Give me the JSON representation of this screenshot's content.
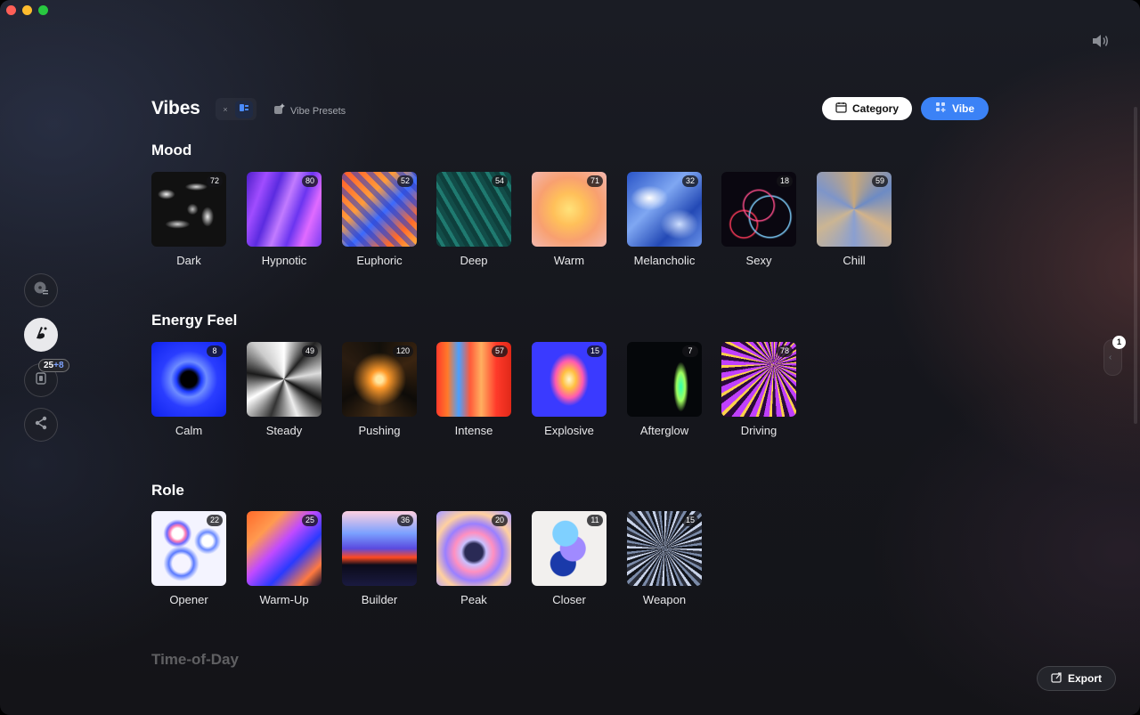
{
  "header": {
    "title": "Vibes",
    "chip_close": "×",
    "presets_label": "Vibe Presets",
    "category_button": "Category",
    "vibe_button": "Vibe"
  },
  "rail": {
    "badge_count": "25",
    "badge_extra": "+8"
  },
  "sections": [
    {
      "title": "Mood",
      "tiles": [
        {
          "label": "Dark",
          "count": "72"
        },
        {
          "label": "Hypnotic",
          "count": "80"
        },
        {
          "label": "Euphoric",
          "count": "52"
        },
        {
          "label": "Deep",
          "count": "54"
        },
        {
          "label": "Warm",
          "count": "71"
        },
        {
          "label": "Melancholic",
          "count": "32"
        },
        {
          "label": "Sexy",
          "count": "18"
        },
        {
          "label": "Chill",
          "count": "59"
        }
      ]
    },
    {
      "title": "Energy Feel",
      "tiles": [
        {
          "label": "Calm",
          "count": "8"
        },
        {
          "label": "Steady",
          "count": "49"
        },
        {
          "label": "Pushing",
          "count": "120"
        },
        {
          "label": "Intense",
          "count": "57"
        },
        {
          "label": "Explosive",
          "count": "15"
        },
        {
          "label": "Afterglow",
          "count": "7"
        },
        {
          "label": "Driving",
          "count": "78"
        }
      ]
    },
    {
      "title": "Role",
      "tiles": [
        {
          "label": "Opener",
          "count": "22"
        },
        {
          "label": "Warm-Up",
          "count": "25"
        },
        {
          "label": "Builder",
          "count": "36"
        },
        {
          "label": "Peak",
          "count": "20"
        },
        {
          "label": "Closer",
          "count": "11"
        },
        {
          "label": "Weapon",
          "count": "15"
        }
      ]
    },
    {
      "title": "Time-of-Day",
      "tiles": []
    }
  ],
  "pager": {
    "page": "1"
  },
  "export_button": "Export",
  "colors": {
    "accent": "#3b82f6",
    "background": "#15161c"
  }
}
